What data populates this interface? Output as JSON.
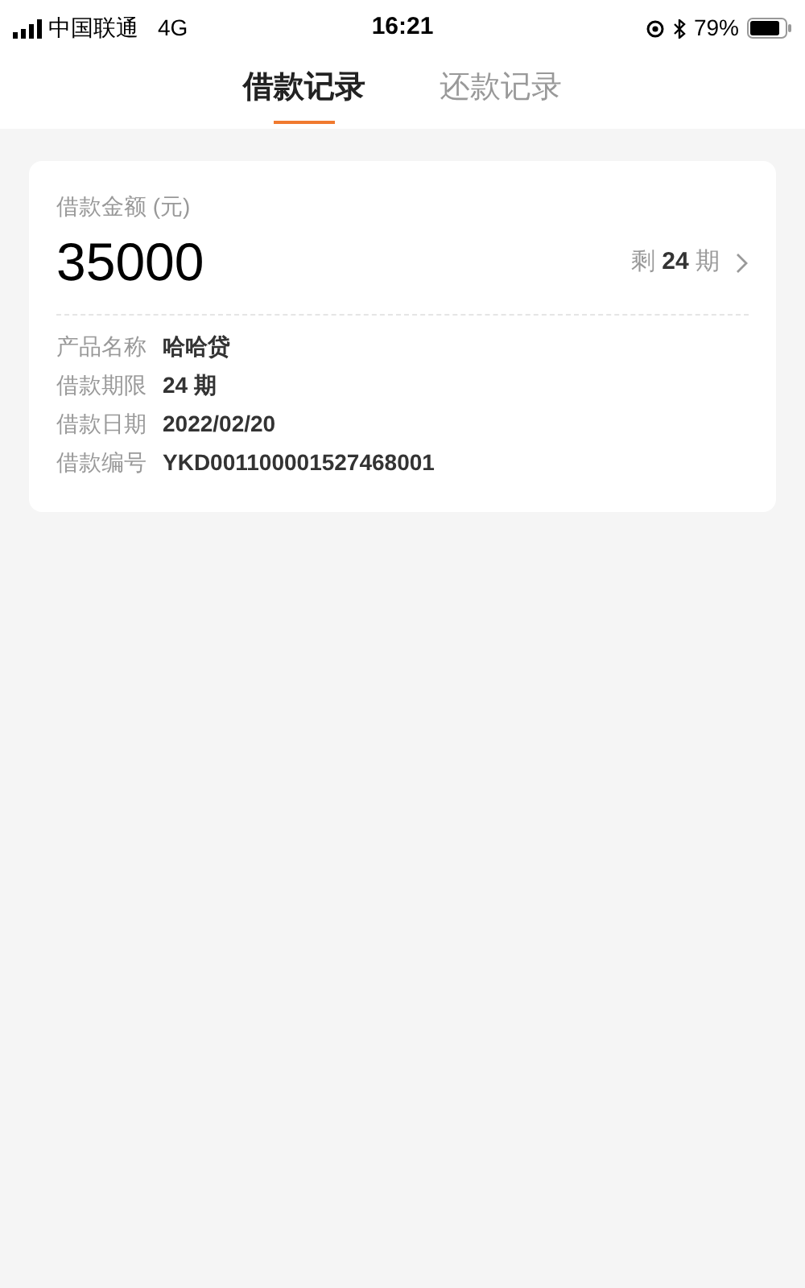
{
  "status_bar": {
    "carrier": "中国联通",
    "network": "4G",
    "time": "16:21",
    "battery": "79%"
  },
  "tabs": [
    {
      "label": "借款记录",
      "selected": true
    },
    {
      "label": "还款记录",
      "selected": false
    }
  ],
  "loan_card": {
    "amount_label": "借款金额 (元)",
    "amount": "35000",
    "remaining": "剩 **24** 期",
    "details": [
      {
        "label": "产品名称",
        "value": "哈哈贷"
      },
      {
        "label": "借款期限",
        "value": "24 期"
      },
      {
        "label": "借款日期",
        "value": "2022/02/20"
      },
      {
        "label": "借款编号",
        "value": "YKD001100001527468001"
      }
    ]
  }
}
